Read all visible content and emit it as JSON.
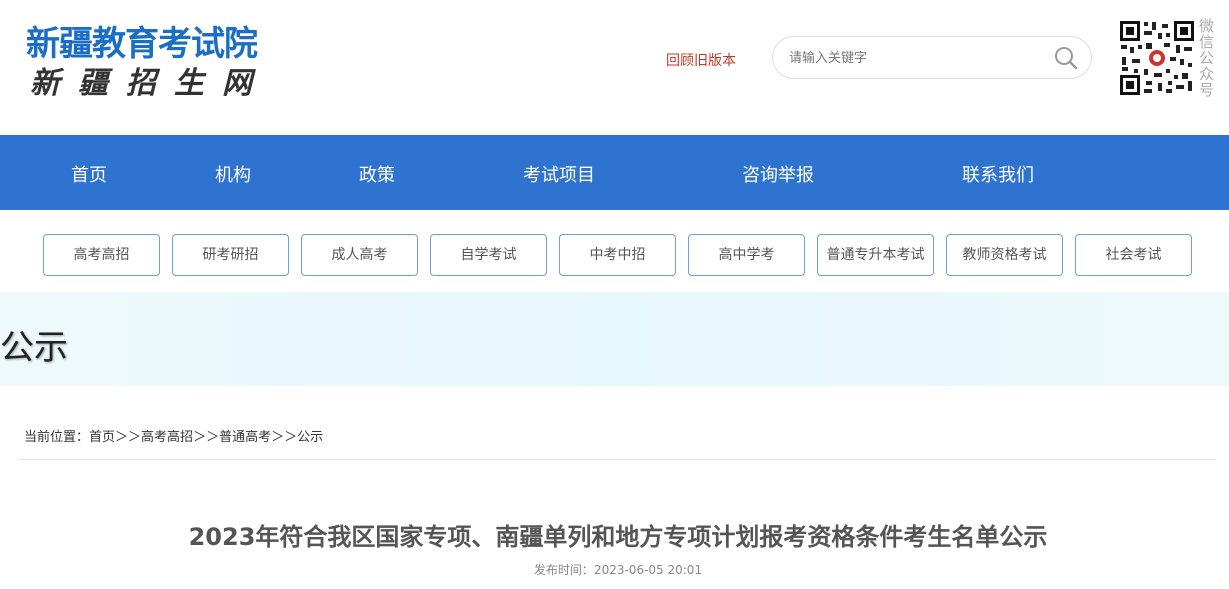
{
  "header": {
    "logo_main": "新疆教育考试院",
    "logo_sub": "新疆招生网",
    "old_version_link": "回顾旧版本",
    "search_placeholder": "请输入关键字",
    "qr_label": "微信公众号"
  },
  "nav": {
    "items": [
      {
        "label": "首页"
      },
      {
        "label": "机构"
      },
      {
        "label": "政策"
      },
      {
        "label": "考试项目"
      },
      {
        "label": "咨询举报"
      },
      {
        "label": "联系我们"
      }
    ]
  },
  "subnav": {
    "items": [
      {
        "label": "高考高招"
      },
      {
        "label": "研考研招"
      },
      {
        "label": "成人高考"
      },
      {
        "label": "自学考试"
      },
      {
        "label": "中考中招"
      },
      {
        "label": "高中学考"
      },
      {
        "label": "普通专升本考试"
      },
      {
        "label": "教师资格考试"
      },
      {
        "label": "社会考试"
      }
    ]
  },
  "banner": {
    "title": "公示"
  },
  "breadcrumb": {
    "prefix": "当前位置：",
    "items": [
      "首页",
      "高考高招",
      "普通高考",
      "公示"
    ],
    "separator": "＞＞"
  },
  "article": {
    "title": "2023年符合我区国家专项、南疆单列和地方专项计划报考资格条件考生名单公示",
    "published_label": "发布时间：",
    "published_time": "2023-06-05 20:01"
  },
  "colors": {
    "brand_blue": "#2f73d0",
    "logo_blue": "#1a6ec5",
    "link_red": "#c0392b",
    "button_border": "#6f9fd8"
  }
}
